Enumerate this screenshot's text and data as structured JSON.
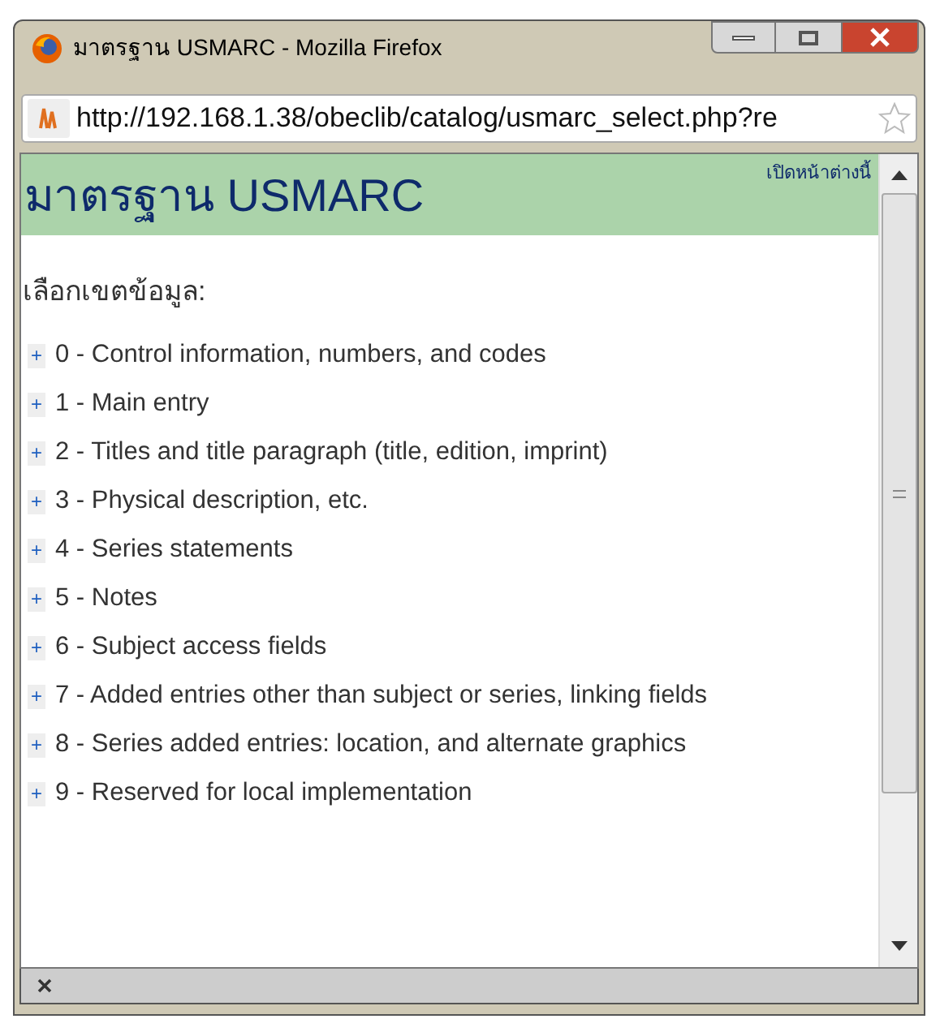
{
  "window": {
    "title": "มาตรฐาน USMARC - Mozilla Firefox"
  },
  "address_bar": {
    "url": "http://192.168.1.38/obeclib/catalog/usmarc_select.php?re"
  },
  "page": {
    "heading": "มาตรฐาน USMARC",
    "header_link": "เปิดหน้าต่างนี้",
    "prompt": "เลือกเขตข้อมูล:",
    "items": [
      {
        "toggle": "+",
        "label": "0 - Control information, numbers, and codes",
        "expanded": false
      },
      {
        "toggle": "+",
        "label": "1 - Main entry",
        "expanded": false
      },
      {
        "toggle": "+",
        "label": "2 - Titles and title paragraph (title, edition, imprint)",
        "expanded": false
      },
      {
        "toggle": "+",
        "label": "3 - Physical description, etc.",
        "expanded": false
      },
      {
        "toggle": "+",
        "label": "4 - Series statements",
        "expanded": false
      },
      {
        "toggle": "+",
        "label": "5 - Notes",
        "expanded": false
      },
      {
        "toggle": "+",
        "label": "6 - Subject access fields",
        "expanded": false
      },
      {
        "toggle": "+",
        "label": "7 - Added entries other than subject or series, linking fields",
        "expanded": false
      },
      {
        "toggle": "+",
        "label": "8 - Series added entries: location, and alternate graphics",
        "expanded": false
      },
      {
        "toggle": "+",
        "label": "9 - Reserved for local implementation",
        "expanded": false
      }
    ]
  }
}
